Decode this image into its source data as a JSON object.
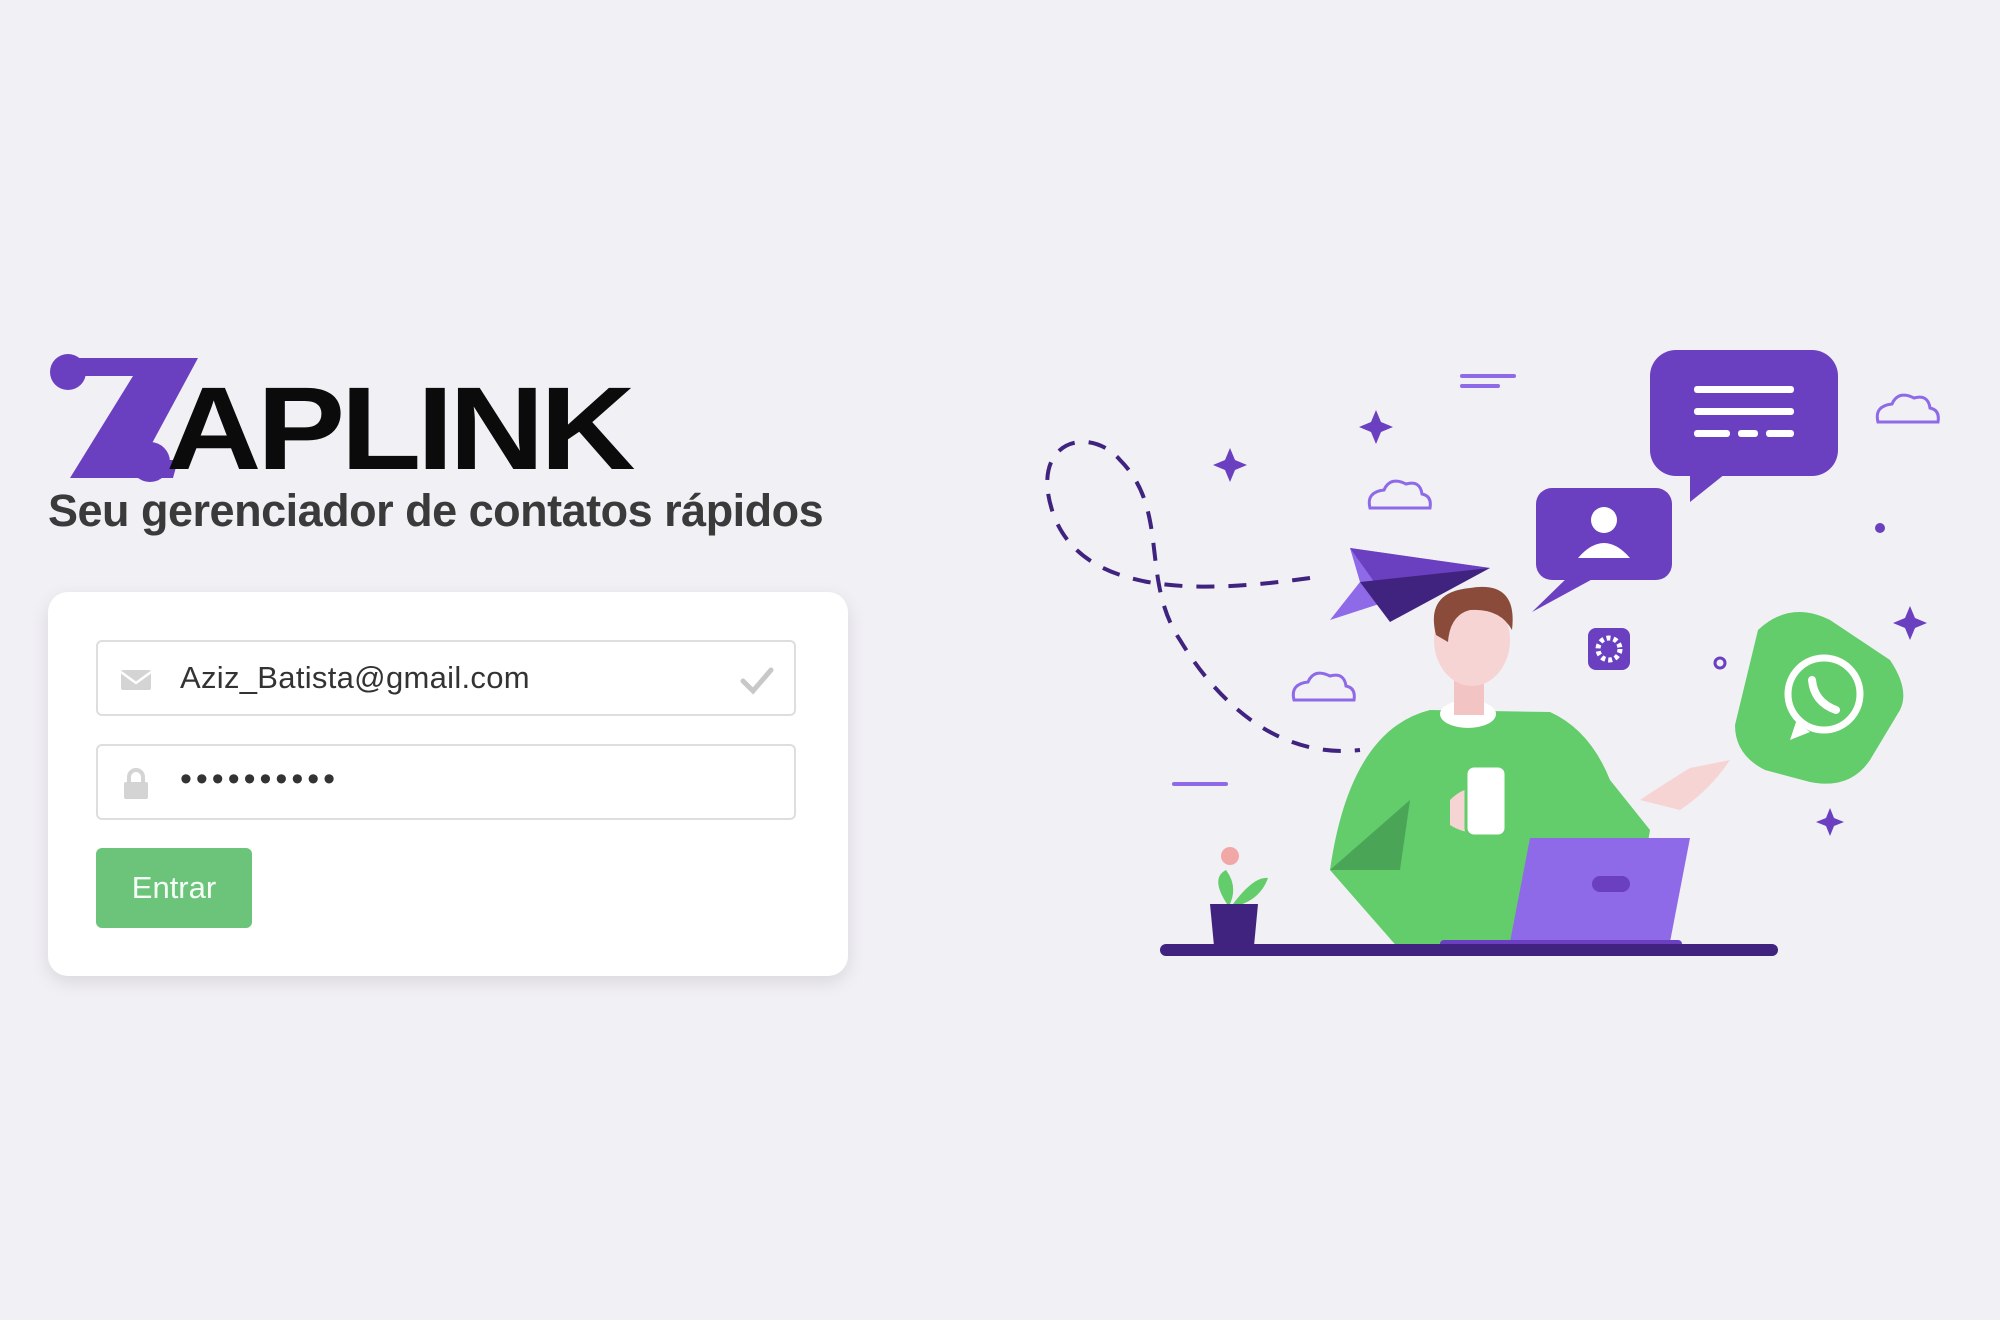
{
  "brand": {
    "name": "APLINK",
    "tagline": "Seu gerenciador de contatos rápidos",
    "accent": "#6a3fc0"
  },
  "login": {
    "email_value": "Aziz_Batista@gmail.com",
    "password_value": "••••••••••",
    "submit_label": "Entrar"
  },
  "colors": {
    "background": "#f1f0f5",
    "button": "#6cc47a",
    "purple": "#6a3fc0",
    "green": "#63cc6b"
  },
  "icons": {
    "email": "envelope-icon",
    "password": "lock-icon",
    "valid": "check-icon"
  }
}
